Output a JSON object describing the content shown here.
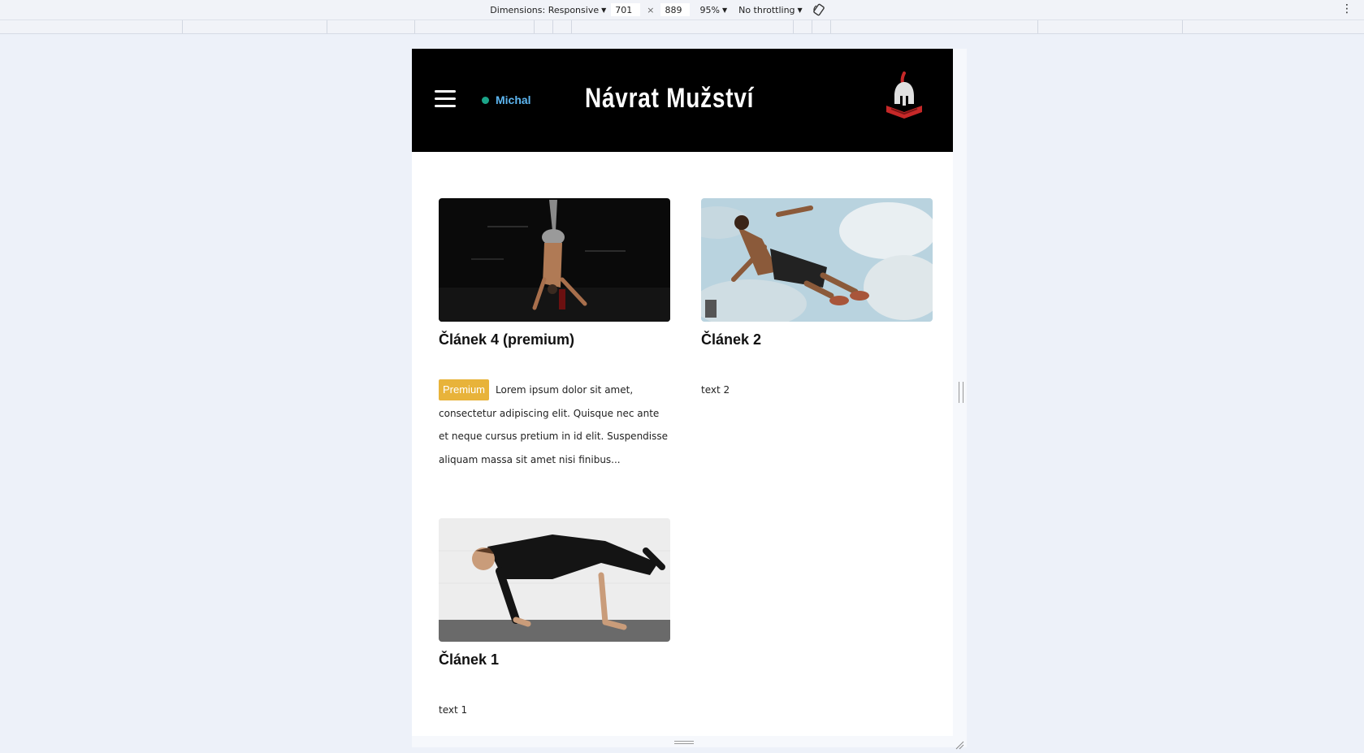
{
  "devtools": {
    "dimensions_label": "Dimensions: Responsive",
    "width_value": "701",
    "times": "×",
    "height_value": "889",
    "zoom_label": "95%",
    "throttling_label": "No throttling"
  },
  "site": {
    "title": "Návrat Mužství",
    "user_name": "Michal",
    "status_color": "#1ba589",
    "header_bg": "#000000"
  },
  "articles": [
    {
      "title": "Článek 4 (premium)",
      "badge": "Premium",
      "excerpt": "Lorem ipsum dolor sit amet, consectetur adipiscing elit. Quisque nec ante et neque cursus pretium in id elit. Suspendisse aliquam massa sit amet nisi finibus..."
    },
    {
      "title": "Článek 2",
      "excerpt": "text 2"
    },
    {
      "title": "Článek 1",
      "excerpt": "text 1"
    }
  ]
}
